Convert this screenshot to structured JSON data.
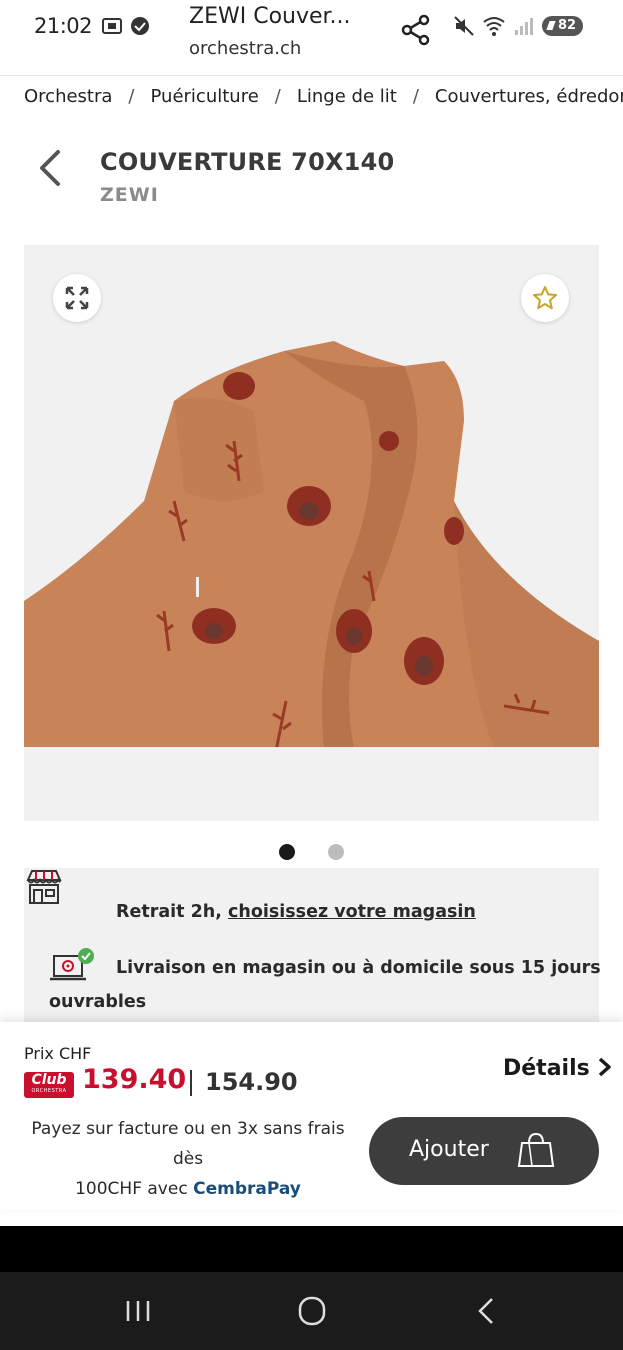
{
  "status_bar": {
    "time": "21:02",
    "battery": "82"
  },
  "browser": {
    "title": "ZEWI Couver...",
    "url": "orchestra.ch"
  },
  "breadcrumb": [
    "Orchestra",
    "Puériculture",
    "Linge de lit",
    "Couvertures, édredons"
  ],
  "product": {
    "title": "COUVERTURE 70X140",
    "brand": "ZEWI"
  },
  "gallery": {
    "image_count": 2,
    "active_index": 1,
    "image_desc": "tan terry blanket with red bear print"
  },
  "delivery": {
    "pickup_prefix": "Retrait 2h,",
    "pickup_link": "choisissez votre magasin",
    "shipping_line1": "Livraison en magasin ou à domicile sous 15 jours",
    "shipping_line2": "ouvrables"
  },
  "pricing": {
    "label": "Prix CHF",
    "club_badge": "Club",
    "club_badge_sub": "ORCHESTRA",
    "club_price": "139.40",
    "regular_price": "154.90",
    "details_label": "Détails",
    "payment_line1": "Payez sur facture ou en 3x sans frais dès",
    "payment_line2_prefix": "100CHF avec",
    "payment_brand": "CembraPay",
    "add_label": "Ajouter"
  },
  "icons": {
    "share": "share-icon",
    "expand": "expand-icon",
    "favorite": "star-icon",
    "store": "store-icon",
    "delivery": "laptop-check-icon",
    "bag": "shopping-bag-icon"
  },
  "colors": {
    "club_red": "#c8102e",
    "button_dark": "#3d3d3d",
    "star_gold": "#c9a227",
    "check_green": "#4caf50",
    "cembrapay_blue": "#1a4e7a"
  }
}
